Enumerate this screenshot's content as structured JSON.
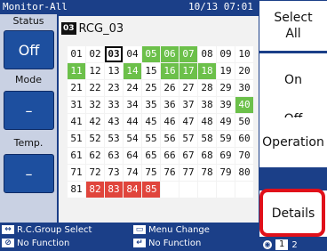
{
  "header": {
    "title": "Monitor-All",
    "datetime": "10/13 07:01"
  },
  "left": {
    "status_label": "Status",
    "status_value": "Off",
    "mode_label": "Mode",
    "mode_value": "–",
    "temp_label": "Temp.",
    "temp_value": "–"
  },
  "group": {
    "number": "03",
    "name": "RCG_03"
  },
  "units": [
    [
      {
        "n": "01"
      },
      {
        "n": "02"
      },
      {
        "n": "03",
        "s": "selected"
      },
      {
        "n": "04"
      },
      {
        "n": "05",
        "s": "on"
      },
      {
        "n": "06",
        "s": "on"
      },
      {
        "n": "07",
        "s": "on"
      },
      {
        "n": "08"
      },
      {
        "n": "09"
      },
      {
        "n": "10"
      }
    ],
    [
      {
        "n": "11",
        "s": "on"
      },
      {
        "n": "12"
      },
      {
        "n": "13"
      },
      {
        "n": "14",
        "s": "on"
      },
      {
        "n": "15"
      },
      {
        "n": "16",
        "s": "on"
      },
      {
        "n": "17",
        "s": "on"
      },
      {
        "n": "18",
        "s": "on"
      },
      {
        "n": "19"
      },
      {
        "n": "20"
      }
    ],
    [
      {
        "n": "21"
      },
      {
        "n": "22"
      },
      {
        "n": "23"
      },
      {
        "n": "24"
      },
      {
        "n": "25"
      },
      {
        "n": "26"
      },
      {
        "n": "27"
      },
      {
        "n": "28"
      },
      {
        "n": "29"
      },
      {
        "n": "30"
      }
    ],
    [
      {
        "n": "31"
      },
      {
        "n": "32"
      },
      {
        "n": "33"
      },
      {
        "n": "34"
      },
      {
        "n": "35"
      },
      {
        "n": "36"
      },
      {
        "n": "37"
      },
      {
        "n": "38"
      },
      {
        "n": "39"
      },
      {
        "n": "40",
        "s": "on"
      }
    ],
    [
      {
        "n": "41"
      },
      {
        "n": "42"
      },
      {
        "n": "43"
      },
      {
        "n": "44"
      },
      {
        "n": "45"
      },
      {
        "n": "46"
      },
      {
        "n": "47"
      },
      {
        "n": "48"
      },
      {
        "n": "49"
      },
      {
        "n": "50"
      }
    ],
    [
      {
        "n": "51"
      },
      {
        "n": "52"
      },
      {
        "n": "53"
      },
      {
        "n": "54"
      },
      {
        "n": "55"
      },
      {
        "n": "56"
      },
      {
        "n": "57"
      },
      {
        "n": "58"
      },
      {
        "n": "59"
      },
      {
        "n": "60"
      }
    ],
    [
      {
        "n": "61"
      },
      {
        "n": "62"
      },
      {
        "n": "63"
      },
      {
        "n": "64"
      },
      {
        "n": "65"
      },
      {
        "n": "66"
      },
      {
        "n": "67"
      },
      {
        "n": "68"
      },
      {
        "n": "69"
      },
      {
        "n": "70"
      }
    ],
    [
      {
        "n": "71"
      },
      {
        "n": "72"
      },
      {
        "n": "73"
      },
      {
        "n": "74"
      },
      {
        "n": "75"
      },
      {
        "n": "76"
      },
      {
        "n": "77"
      },
      {
        "n": "78"
      },
      {
        "n": "79"
      },
      {
        "n": "80"
      }
    ],
    [
      {
        "n": "81"
      },
      {
        "n": "82",
        "s": "error"
      },
      {
        "n": "83",
        "s": "error"
      },
      {
        "n": "84",
        "s": "error"
      },
      {
        "n": "85",
        "s": "error"
      },
      {
        "n": ""
      },
      {
        "n": ""
      },
      {
        "n": ""
      },
      {
        "n": ""
      },
      {
        "n": ""
      }
    ]
  ],
  "right_buttons": [
    {
      "id": "select-all",
      "label": "Select\nAll"
    },
    {
      "id": "on",
      "label": "On"
    },
    {
      "id": "off",
      "label": "Off"
    },
    {
      "id": "operation",
      "label": "Operation"
    },
    {
      "id": "details",
      "label": "Details"
    }
  ],
  "footer": {
    "rc_group_select": "R.C.Group Select",
    "menu_change": "Menu Change",
    "no_function_1": "No Function",
    "no_function_2": "No Function"
  },
  "pager": {
    "page": "1",
    "other": "2"
  },
  "colors": {
    "panel_blue": "#1b3f88",
    "on_green": "#6cc04a",
    "error_red": "#e0453c",
    "highlight": "#e0101a"
  },
  "icons": [
    "left-right-arrow-icon",
    "menu-icon",
    "no-function-icon",
    "enter-icon"
  ]
}
